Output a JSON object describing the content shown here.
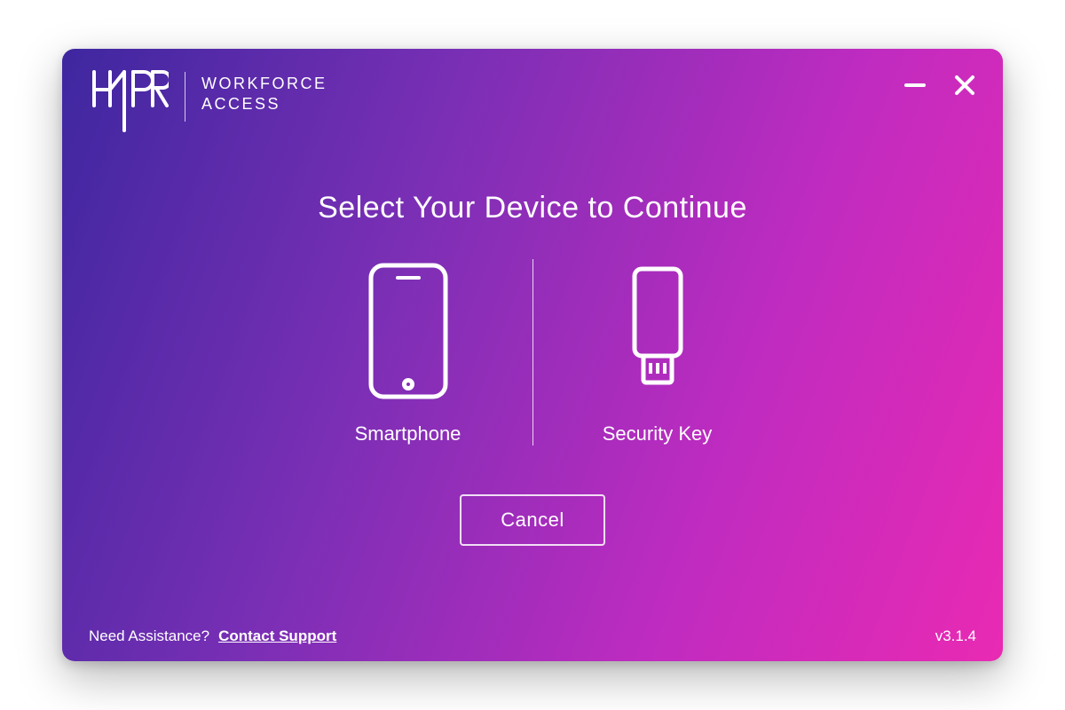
{
  "brand": {
    "line1": "WORKFORCE",
    "line2": "ACCESS"
  },
  "heading": "Select Your Device to Continue",
  "options": {
    "smartphone_label": "Smartphone",
    "security_key_label": "Security Key"
  },
  "buttons": {
    "cancel": "Cancel"
  },
  "footer": {
    "assist_prompt": "Need Assistance?",
    "support_link": "Contact Support",
    "version": "v3.1.4"
  }
}
